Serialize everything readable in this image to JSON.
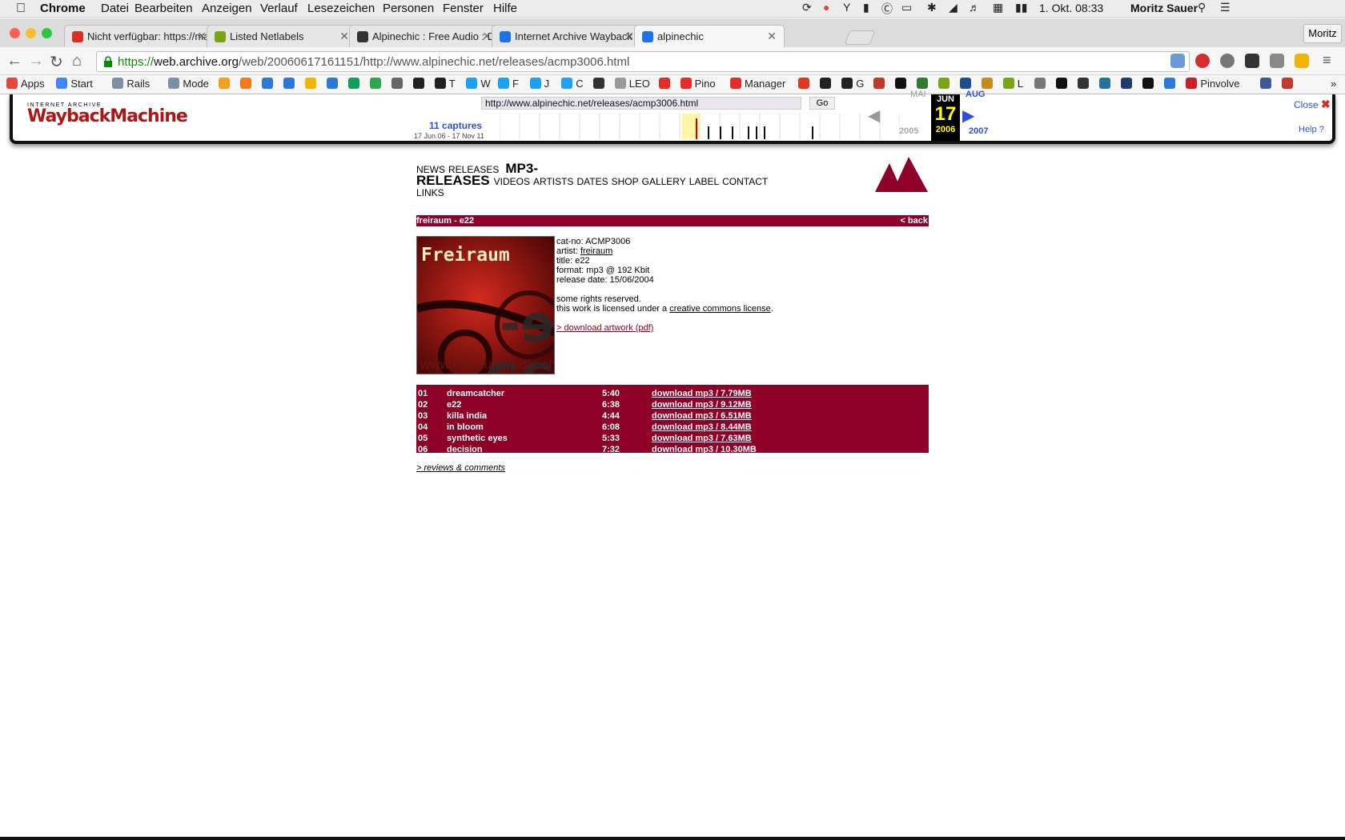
{
  "menubar": {
    "app": "Chrome",
    "items": [
      "Datei",
      "Bearbeiten",
      "Anzeigen",
      "Verlauf",
      "Lesezeichen",
      "Personen",
      "Fenster",
      "Hilfe"
    ],
    "datetime": "1. Okt.  08:33",
    "user": "Moritz Sauer"
  },
  "tabs": [
    {
      "title": "Nicht verfügbar: https://ma",
      "icon": "gmail-icon",
      "color": "#d93025"
    },
    {
      "title": "Listed Netlabels",
      "icon": "netlabel-icon",
      "color": "#7aa316"
    },
    {
      "title": "Alpinechic : Free Audio : D",
      "icon": "archive-icon",
      "color": "#333333"
    },
    {
      "title": "Internet Archive Wayback M",
      "icon": "wayback-icon",
      "color": "#1a73e8"
    },
    {
      "title": "alpinechic",
      "icon": "wayback-icon",
      "color": "#1a73e8"
    }
  ],
  "profile": "Moritz",
  "address": {
    "scheme": "https://",
    "domain": "web.archive.org",
    "path": "/web/20060617161151/http://www.alpinechic.net/releases/acmp3006.html"
  },
  "bookmarks": [
    {
      "label": "Apps",
      "icon": "apps-icon",
      "color": "#e8453c"
    },
    {
      "label": "Start",
      "icon": "google-icon",
      "color": "#4285f4"
    },
    {
      "label": "Rails",
      "icon": "folder-icon",
      "color": "#7c8fa3"
    },
    {
      "label": "Mode",
      "icon": "folder-icon",
      "color": "#7c8fa3"
    },
    {
      "label": "",
      "icon": "flame-icon",
      "color": "#f4a01c"
    },
    {
      "label": "",
      "icon": "flame-icon",
      "color": "#f47a1c"
    },
    {
      "label": "",
      "icon": "contacts-icon",
      "color": "#2b79d6"
    },
    {
      "label": "",
      "icon": "calendar-icon",
      "color": "#2b79d6"
    },
    {
      "label": "",
      "icon": "drive-icon",
      "color": "#f3b400"
    },
    {
      "label": "",
      "icon": "docs-icon",
      "color": "#2b79d6"
    },
    {
      "label": "",
      "icon": "sheets-icon",
      "color": "#0f9d58"
    },
    {
      "label": "",
      "icon": "plus-icon",
      "color": "#2ea84a"
    },
    {
      "label": "",
      "icon": "trash-icon",
      "color": "#666666"
    },
    {
      "label": "",
      "icon": "ball-icon",
      "color": "#222222"
    },
    {
      "label": "T",
      "icon": "ball-icon",
      "color": "#222222"
    },
    {
      "label": "W",
      "icon": "twitter-icon",
      "color": "#1da1f2"
    },
    {
      "label": "F",
      "icon": "twitter-icon",
      "color": "#1da1f2"
    },
    {
      "label": "J",
      "icon": "twitter-icon",
      "color": "#1da1f2"
    },
    {
      "label": "C",
      "icon": "twitter-icon",
      "color": "#1da1f2"
    },
    {
      "label": "",
      "icon": "layers-icon",
      "color": "#333333"
    },
    {
      "label": "LEO",
      "icon": "page-icon",
      "color": "#999999"
    },
    {
      "label": "",
      "icon": "youtube-icon",
      "color": "#e52d27"
    },
    {
      "label": "Pino",
      "icon": "youtube-icon",
      "color": "#e52d27"
    },
    {
      "label": "Manager",
      "icon": "youtube-icon",
      "color": "#e52d27"
    },
    {
      "label": "",
      "icon": "tomato-icon",
      "color": "#e03a1e"
    },
    {
      "label": "",
      "icon": "github-icon",
      "color": "#222222"
    },
    {
      "label": "G",
      "icon": "github-icon",
      "color": "#222222"
    },
    {
      "label": "",
      "icon": "pen-icon",
      "color": "#c0392b"
    },
    {
      "label": "",
      "icon": "f-icon",
      "color": "#111111"
    },
    {
      "label": "",
      "icon": "flask-icon",
      "color": "#2e7d32"
    },
    {
      "label": "",
      "icon": "netlabel-icon",
      "color": "#7aa316"
    },
    {
      "label": "",
      "icon": "k-icon",
      "color": "#1b4f8a"
    },
    {
      "label": "",
      "icon": "books-icon",
      "color": "#c98a1c"
    },
    {
      "label": "L",
      "icon": "netlabel-icon",
      "color": "#7aa316"
    },
    {
      "label": "",
      "icon": "at-icon",
      "color": "#777777"
    },
    {
      "label": "",
      "icon": "nyt-icon",
      "color": "#111111"
    },
    {
      "label": "",
      "icon": "bbc-icon",
      "color": "#333333"
    },
    {
      "label": "",
      "icon": "wordpress-icon",
      "color": "#21759b"
    },
    {
      "label": "",
      "icon": "ard-icon",
      "color": "#1e3a6e"
    },
    {
      "label": "",
      "icon": "z-icon",
      "color": "#111111"
    },
    {
      "label": "",
      "icon": "bird-icon",
      "color": "#2b79d6"
    },
    {
      "label": "Pinvolve",
      "icon": "pinterest-icon",
      "color": "#cb2027"
    },
    {
      "label": "",
      "icon": "facebook-icon",
      "color": "#3b5998"
    },
    {
      "label": "",
      "icon": "flask-icon",
      "color": "#c0392b"
    }
  ],
  "wayback": {
    "logo_top": "INTERNET ARCHIVE",
    "logo_main": "WaybackMachine",
    "url": "http://www.alpinechic.net/releases/acmp3006.html",
    "go": "Go",
    "captures": "11 captures",
    "range": "17 Jun 06 - 17 Nov 11",
    "prev_month": "MAI",
    "cur_month": "JUN",
    "next_month": "AUG",
    "day": "17",
    "prev_year": "2005",
    "cur_year": "2006",
    "next_year": "2007",
    "close": "Close",
    "help": "Help",
    "capture_ticks": [
      0.49,
      0.52,
      0.55,
      0.58,
      0.62,
      0.64,
      0.66,
      0.78
    ]
  },
  "site": {
    "nav": [
      "NEWS",
      "RELEASES",
      "MP3-RELEASES",
      "VIDEOS",
      "ARTISTS",
      "DATES",
      "SHOP",
      "GALLERY",
      "LABEL",
      "CONTACT",
      "LINKS"
    ],
    "release_header": "freiraum - e22",
    "back": "< back",
    "cover_title": "Freiraum",
    "cover_text": "e-22",
    "cover_url": "www.freiraummusic.ch",
    "info": {
      "cat": "cat-no: ACMP3006",
      "artist_label": "artist: ",
      "artist": "freiraum",
      "title": "title: e22",
      "format": "format: mp3 @ 192 Kbit",
      "release": "release date: 15/06/2004",
      "rights": "some rights reserved.",
      "license_prefix": "this work is licensed under a ",
      "license_link": "creative commons license",
      "license_suffix": ".",
      "artwork": "> download artwork (pdf)"
    },
    "tracks": [
      {
        "no": "01",
        "name": "dreamcatcher",
        "time": "5:40",
        "dl": "download mp3 / 7.79MB"
      },
      {
        "no": "02",
        "name": "e22",
        "time": "6:38",
        "dl": "download mp3 / 9.12MB"
      },
      {
        "no": "03",
        "name": "killa india",
        "time": "4:44",
        "dl": "download mp3 / 6.51MB"
      },
      {
        "no": "04",
        "name": "in bloom",
        "time": "6:08",
        "dl": "download mp3 / 8.44MB"
      },
      {
        "no": "05",
        "name": "synthetic eyes",
        "time": "5:33",
        "dl": "download mp3 / 7.63MB"
      },
      {
        "no": "06",
        "name": "decision",
        "time": "7:32",
        "dl": "download mp3 / 10.30MB"
      }
    ],
    "reviews": "> reviews & comments",
    "accent": "#8e0027"
  }
}
